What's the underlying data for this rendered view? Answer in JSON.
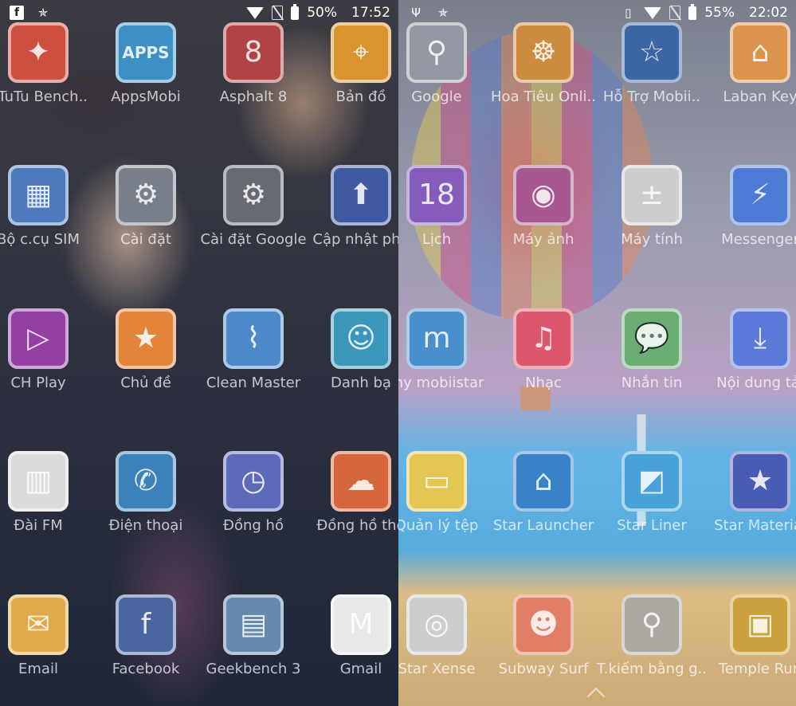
{
  "left": {
    "status": {
      "battery": "50%",
      "time": "17:52",
      "icons_left": [
        "facebook-icon",
        "star-icon"
      ],
      "icons_right": [
        "wifi-icon",
        "no-sim-icon",
        "battery-icon"
      ]
    },
    "apps": [
      {
        "label": "nTuTu Bench..",
        "icon": "antutu-icon",
        "color": "#c94030",
        "glyph": "✦"
      },
      {
        "label": "AppsMobi",
        "icon": "appsmobi-icon",
        "color": "#2e86c1",
        "glyph": "APPS"
      },
      {
        "label": "Asphalt 8",
        "icon": "asphalt-icon",
        "color": "#a33",
        "glyph": "8"
      },
      {
        "label": "Bản đồ",
        "icon": "map-pin-icon",
        "color": "#d68a1e",
        "glyph": "⌖"
      },
      {
        "label": "Bộ c.cụ SIM",
        "icon": "sim-icon",
        "color": "#3d6fb8",
        "glyph": "▦"
      },
      {
        "label": "Cài đặt",
        "icon": "gear-icon",
        "color": "#6d7480",
        "glyph": "⚙"
      },
      {
        "label": "Cài đặt Google",
        "icon": "google-settings-icon",
        "color": "#5b5e66",
        "glyph": "⚙"
      },
      {
        "label": "Cập nhật phầ",
        "icon": "update-arrow-icon",
        "color": "#2f4c9a",
        "glyph": "⬆"
      },
      {
        "label": "CH Play",
        "icon": "play-store-icon",
        "color": "#8a2f9c",
        "glyph": "▷"
      },
      {
        "label": "Chủ đề",
        "icon": "themes-icon",
        "color": "#e07a2a",
        "glyph": "★"
      },
      {
        "label": "Clean Master",
        "icon": "broom-icon",
        "color": "#3e7ec4",
        "glyph": "⌇"
      },
      {
        "label": "Danh bạ",
        "icon": "contacts-icon",
        "color": "#2b8fb3",
        "glyph": "☺"
      },
      {
        "label": "Đài FM",
        "icon": "radio-icon",
        "color": "#d9d9d9",
        "glyph": "▥"
      },
      {
        "label": "Điện thoại",
        "icon": "phone-icon",
        "color": "#2b78b5",
        "glyph": "✆"
      },
      {
        "label": "Đồng hồ",
        "icon": "clock-icon",
        "color": "#4f5fb4",
        "glyph": "◷"
      },
      {
        "label": "Đồng hồ thờ",
        "icon": "weather-clock-icon",
        "color": "#d25a2c",
        "glyph": "☁"
      },
      {
        "label": "Email",
        "icon": "email-icon",
        "color": "#e0a23a",
        "glyph": "✉"
      },
      {
        "label": "Facebook",
        "icon": "facebook-app-icon",
        "color": "#3b5998",
        "glyph": "f"
      },
      {
        "label": "Geekbench 3",
        "icon": "geekbench-icon",
        "color": "#5a7fa8",
        "glyph": "▤"
      },
      {
        "label": "Gmail",
        "icon": "gmail-icon",
        "color": "#e6e6e6",
        "glyph": "M"
      }
    ]
  },
  "right": {
    "status": {
      "battery": "55%",
      "time": "22:02",
      "icons_left": [
        "usb-icon",
        "star-icon"
      ],
      "icons_right": [
        "vibrate-icon",
        "wifi-icon",
        "no-sim-icon",
        "battery-charging-icon"
      ]
    },
    "apps": [
      {
        "label": "Google",
        "icon": "search-icon",
        "color": "#8a8f99",
        "glyph": "⚲"
      },
      {
        "label": "Hoa Tiêu Onli..",
        "icon": "helm-icon",
        "color": "#c8832e",
        "glyph": "☸"
      },
      {
        "label": "Hỗ Trợ Mobii..",
        "icon": "star-support-icon",
        "color": "#2d5a9e",
        "glyph": "☆"
      },
      {
        "label": "Laban Key",
        "icon": "laban-key-icon",
        "color": "#d98a3c",
        "glyph": "⌂"
      },
      {
        "label": "Lịch",
        "icon": "calendar-icon",
        "color": "#7b4fb5",
        "glyph": "18"
      },
      {
        "label": "Máy ảnh",
        "icon": "camera-icon",
        "color": "#a04a86",
        "glyph": "◉"
      },
      {
        "label": "Máy tính",
        "icon": "calculator-icon",
        "color": "#c9c9c9",
        "glyph": "±"
      },
      {
        "label": "Messenger",
        "icon": "messenger-icon",
        "color": "#3d6fd1",
        "glyph": "⚡"
      },
      {
        "label": "my mobiistar",
        "icon": "mobiistar-icon",
        "color": "#3a86c9",
        "glyph": "m"
      },
      {
        "label": "Nhạc",
        "icon": "music-icon",
        "color": "#d9495f",
        "glyph": "♫"
      },
      {
        "label": "Nhắn tin",
        "icon": "message-icon",
        "color": "#5fa86a",
        "glyph": "💬"
      },
      {
        "label": "Nội dung tải",
        "icon": "download-icon",
        "color": "#4f6fd6",
        "glyph": "⤓"
      },
      {
        "label": "Quản lý tệp",
        "icon": "folder-icon",
        "color": "#e2c244",
        "glyph": "▭"
      },
      {
        "label": "Star Launcher",
        "icon": "launcher-icon",
        "color": "#2a78c4",
        "glyph": "⌂"
      },
      {
        "label": "Star Liner",
        "icon": "liner-icon",
        "color": "#3a9bd4",
        "glyph": "◩"
      },
      {
        "label": "Star Material",
        "icon": "star-material-icon",
        "color": "#3a4fb0",
        "glyph": "★"
      },
      {
        "label": "Star Xense",
        "icon": "xense-icon",
        "color": "#c9c9c9",
        "glyph": "◎"
      },
      {
        "label": "Subway Surf",
        "icon": "subway-surf-icon",
        "color": "#e0745a",
        "glyph": "☻"
      },
      {
        "label": "T.kiếm bằng g..",
        "icon": "voice-search-icon",
        "color": "#a4a09a",
        "glyph": "⚲"
      },
      {
        "label": "Temple Run",
        "icon": "temple-run-icon",
        "color": "#c79c2e",
        "glyph": "▣"
      }
    ]
  }
}
